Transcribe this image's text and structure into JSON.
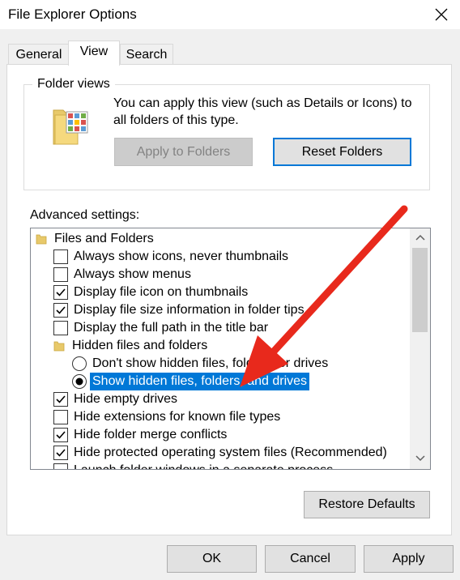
{
  "window": {
    "title": "File Explorer Options"
  },
  "tabs": [
    {
      "label": "General"
    },
    {
      "label": "View"
    },
    {
      "label": "Search"
    }
  ],
  "folder_views": {
    "legend": "Folder views",
    "description": "You can apply this view (such as Details or Icons) to all folders of this type.",
    "apply_button": "Apply to Folders",
    "reset_button": "Reset Folders"
  },
  "advanced": {
    "label": "Advanced settings:",
    "items": [
      {
        "kind": "folder",
        "label": "Files and Folders"
      },
      {
        "kind": "checkbox",
        "checked": false,
        "label": "Always show icons, never thumbnails"
      },
      {
        "kind": "checkbox",
        "checked": false,
        "label": "Always show menus"
      },
      {
        "kind": "checkbox",
        "checked": true,
        "label": "Display file icon on thumbnails"
      },
      {
        "kind": "checkbox",
        "checked": true,
        "label": "Display file size information in folder tips"
      },
      {
        "kind": "checkbox",
        "checked": false,
        "label": "Display the full path in the title bar"
      },
      {
        "kind": "folder",
        "label": "Hidden files and folders"
      },
      {
        "kind": "radio",
        "checked": false,
        "label": "Don't show hidden files, folders, or drives"
      },
      {
        "kind": "radio",
        "checked": true,
        "label": "Show hidden files, folders, and drives"
      },
      {
        "kind": "checkbox",
        "checked": true,
        "label": "Hide empty drives"
      },
      {
        "kind": "checkbox",
        "checked": false,
        "label": "Hide extensions for known file types"
      },
      {
        "kind": "checkbox",
        "checked": true,
        "label": "Hide folder merge conflicts"
      },
      {
        "kind": "checkbox",
        "checked": true,
        "label": "Hide protected operating system files (Recommended)"
      },
      {
        "kind": "checkbox",
        "checked": false,
        "label": "Launch folder windows in a separate process"
      }
    ]
  },
  "restore_button": "Restore Defaults",
  "footer": {
    "ok": "OK",
    "cancel": "Cancel",
    "apply": "Apply"
  },
  "colors": {
    "selection": "#0078d7",
    "focus_border": "#0078d7",
    "annotation_arrow": "#e8291c"
  },
  "icons": {
    "close": "close-icon",
    "folder_view": "folder-view-icon",
    "folder": "folder-icon",
    "scroll_up": "scroll-up-arrow-icon",
    "scroll_down": "scroll-down-arrow-icon"
  }
}
